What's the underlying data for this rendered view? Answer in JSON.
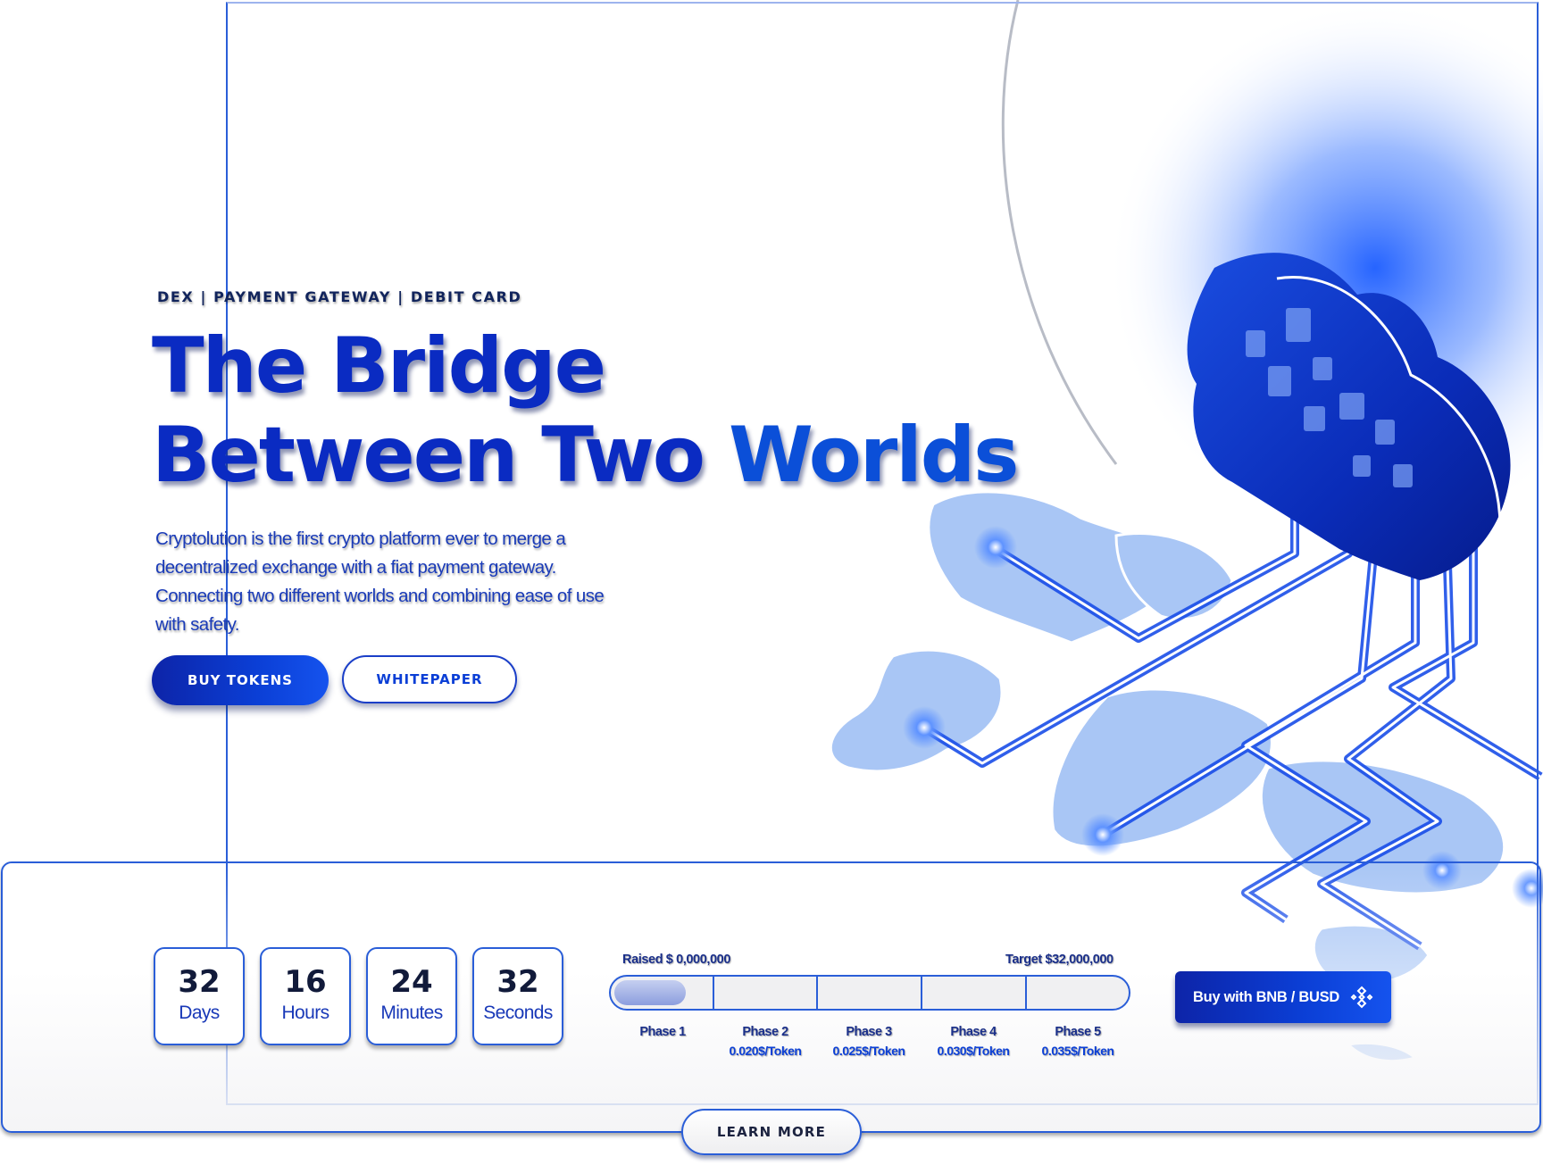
{
  "hero": {
    "tagline": "DEX | PAYMENT GATEWAY | DEBIT CARD",
    "title_line1": "The Bridge",
    "title_line2_a": "Between Two ",
    "title_line2_b": "Worlds",
    "description": "Cryptolution is the first crypto platform ever to merge a decentralized exchange with a fiat payment gateway. Connecting two different worlds and combining ease of use with safety.",
    "buy_tokens_label": "BUY TOKENS",
    "whitepaper_label": "WHITEPAPER"
  },
  "countdown": {
    "items": [
      {
        "value": "32",
        "label": "Days"
      },
      {
        "value": "16",
        "label": "Hours"
      },
      {
        "value": "24",
        "label": "Minutes"
      },
      {
        "value": "32",
        "label": "Seconds"
      }
    ]
  },
  "presale": {
    "raised_label": "Raised $ 0,000,000",
    "target_label": "Target $32,000,000",
    "progress_fraction": 0.14,
    "phases": [
      {
        "name": "Phase 1",
        "price": ""
      },
      {
        "name": "Phase 2",
        "price": "0.020$/Token"
      },
      {
        "name": "Phase 3",
        "price": "0.025$/Token"
      },
      {
        "name": "Phase 4",
        "price": "0.030$/Token"
      },
      {
        "name": "Phase 5",
        "price": "0.035$/Token"
      }
    ],
    "buy_label": "Buy with BNB / BUSD",
    "buy_icon": "bnb-icon"
  },
  "footer": {
    "learn_more_label": "LEARN MORE"
  },
  "colors": {
    "primary": "#0b3fd6",
    "primary_dark": "#0d24a8",
    "map": "#a9c6f5",
    "text_dark": "#111a3a"
  }
}
